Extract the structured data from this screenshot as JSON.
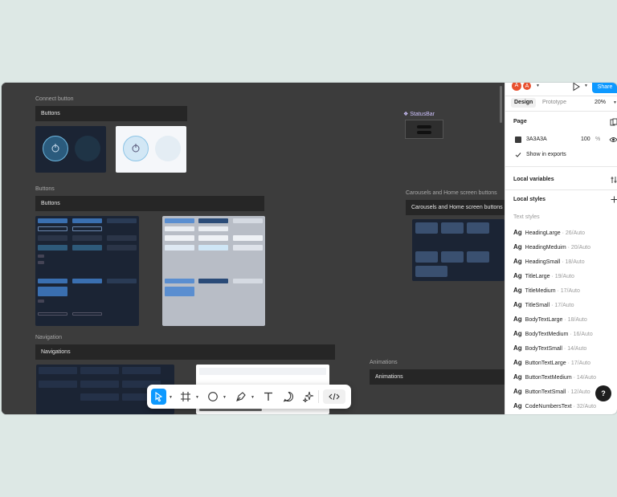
{
  "canvas": {
    "sections": {
      "connect_label": "Connect button",
      "connect_bar": "Buttons",
      "buttons_label": "Buttons",
      "buttons_bar": "Buttons",
      "navigation_label": "Navigation",
      "navigation_bar": "Navigations",
      "carousels_label": "Carousels and Home screen buttons",
      "carousels_bar": "Carousels and Home screen buttons",
      "animations_label": "Animations",
      "animations_bar": "Animations",
      "statusbar_label": "StatusBar"
    }
  },
  "panel": {
    "avatars": [
      "A",
      "A"
    ],
    "share_label": "Share",
    "tabs": {
      "design": "Design",
      "prototype": "Prototype"
    },
    "zoom": "20%",
    "page": {
      "title": "Page",
      "color_hex": "3A3A3A",
      "opacity": "100",
      "percent": "%",
      "show_in_exports": "Show in exports",
      "swatch_color": "#3a3a3a"
    },
    "local_variables": "Local variables",
    "local_styles": "Local styles",
    "text_styles_label": "Text styles",
    "text_styles": [
      {
        "ag": "Ag",
        "name": "HeadingLarge",
        "meta": " · 26/Auto"
      },
      {
        "ag": "Ag",
        "name": "HeadingMeduim",
        "meta": " · 20/Auto"
      },
      {
        "ag": "Ag",
        "name": "HeadingSmall",
        "meta": " · 18/Auto"
      },
      {
        "ag": "Ag",
        "name": "TitleLarge",
        "meta": " · 19/Auto"
      },
      {
        "ag": "Ag",
        "name": "TitleMedium",
        "meta": " · 17/Auto"
      },
      {
        "ag": "Ag",
        "name": "TitleSmall",
        "meta": " · 17/Auto"
      },
      {
        "ag": "Ag",
        "name": "BodyTextLarge",
        "meta": " · 18/Auto"
      },
      {
        "ag": "Ag",
        "name": "BodyTextMedium",
        "meta": " · 16/Auto"
      },
      {
        "ag": "Ag",
        "name": "BodyTextSmall",
        "meta": " · 14/Auto"
      },
      {
        "ag": "Ag",
        "name": "ButtonTextLarge",
        "meta": " · 17/Auto"
      },
      {
        "ag": "Ag",
        "name": "ButtonTextMedium",
        "meta": " · 14/Auto"
      },
      {
        "ag": "Ag",
        "name": "ButtonTextSmall",
        "meta": " · 12/Auto"
      },
      {
        "ag": "Ag",
        "name": "CodeNumbersText",
        "meta": " · 32/Auto"
      }
    ],
    "help": "?"
  },
  "colors": {
    "accent": "#0d99ff",
    "canvas": "#3c3c3c",
    "avatar": "#e8502e"
  }
}
